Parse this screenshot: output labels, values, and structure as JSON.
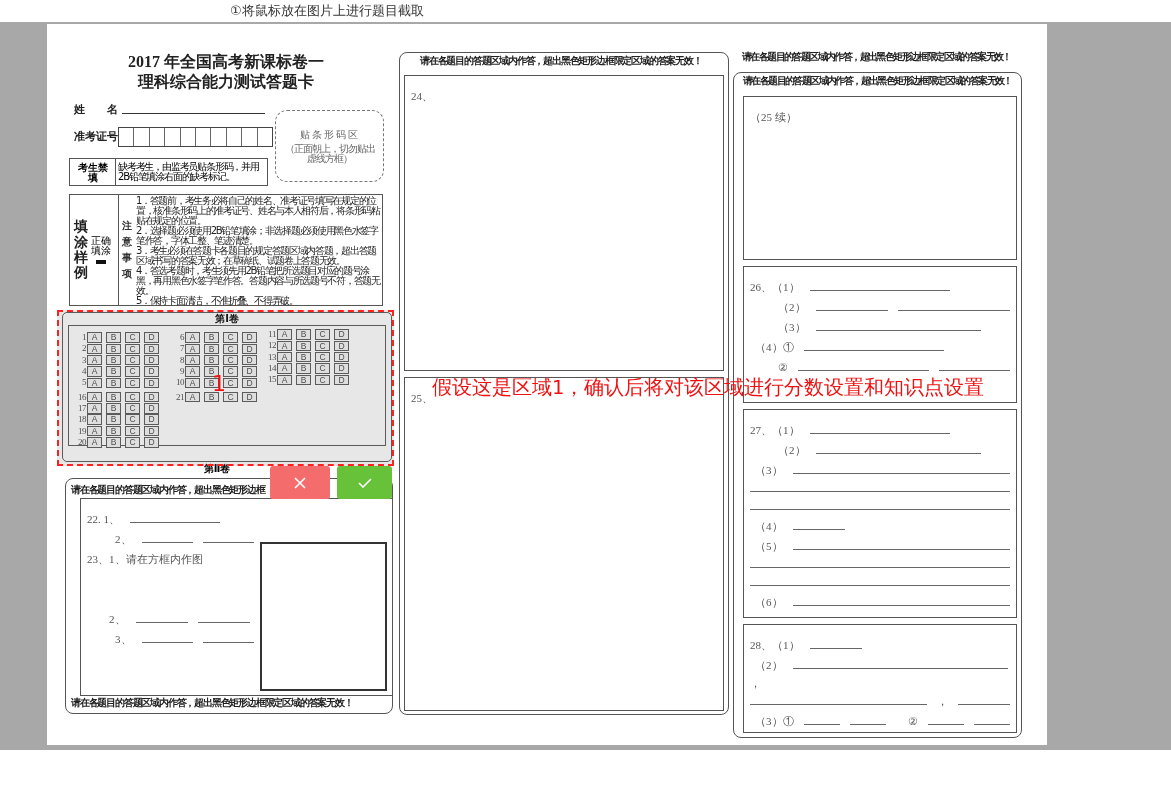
{
  "page_hint": "①将鼠标放在图片上进行题目截取",
  "answer_sheet": {
    "title": [
      "2017 年全国高考新课标卷一",
      "理科综合能力测试答题卡"
    ],
    "name_label": "姓　　名",
    "exam_number_label": "准考证号",
    "barcode_area": {
      "title": "贴条形码区",
      "note": "（正面朝上，切勿贴出虚线方框）"
    },
    "absent": {
      "label": "考生禁填",
      "text": "缺考考生，由监考员贴条形码，并用2B铅笔填涂右面的缺考标记。"
    },
    "fill_example": {
      "label": "填涂样例",
      "sample_label": "正确填涂",
      "notice_label": "注意事项",
      "notices": [
        "1．答题前，考生务必将自己的姓名、准考证号填写在规定的位置，核准条形码上的准考证号、姓名与本人相符后，将条形码粘贴在规定的位置。",
        "2．选择题必须使用2B铅笔填涂；非选择题必须使用黑色水签字笔作答，字体工整、笔迹清楚。",
        "3．考生必须在答题卡各题目的规定答题区域内答题，超出答题区域书写的答案无效；在草稿纸、试题卷上答题无效。",
        "4．答选考题时，考生须先用2B铅笔把所选题目对应的题号涂黑，再用黑色水签字笔作答。答题内容与所选题号不符，答题无效。",
        "5．保持卡面清洁，不准折叠、不得弄破。"
      ]
    },
    "section_1": {
      "title": "第Ⅰ卷",
      "groups": [
        [
          {
            "number": "1",
            "options": [
              "A",
              "B",
              "C",
              "D"
            ]
          },
          {
            "number": "2",
            "options": [
              "A",
              "B",
              "C",
              "D"
            ]
          },
          {
            "number": "3",
            "options": [
              "A",
              "B",
              "C",
              "D"
            ]
          },
          {
            "number": "4",
            "options": [
              "A",
              "B",
              "C",
              "D"
            ]
          },
          {
            "number": "5",
            "options": [
              "A",
              "B",
              "C",
              "D"
            ]
          }
        ],
        [
          {
            "number": "6",
            "options": [
              "A",
              "B",
              "C",
              "D"
            ]
          },
          {
            "number": "7",
            "options": [
              "A",
              "B",
              "C",
              "D"
            ]
          },
          {
            "number": "8",
            "options": [
              "A",
              "B",
              "C",
              "D"
            ]
          },
          {
            "number": "9",
            "options": [
              "A",
              "B",
              "C",
              "D"
            ]
          },
          {
            "number": "10",
            "options": [
              "A",
              "B",
              "C",
              "D"
            ]
          }
        ],
        [
          {
            "number": "11",
            "options": [
              "A",
              "B",
              "C",
              "D"
            ]
          },
          {
            "number": "12",
            "options": [
              "A",
              "B",
              "C",
              "D"
            ]
          },
          {
            "number": "13",
            "options": [
              "A",
              "B",
              "C",
              "D"
            ]
          },
          {
            "number": "14",
            "options": [
              "A",
              "B",
              "C",
              "D"
            ]
          },
          {
            "number": "15",
            "options": [
              "A",
              "B",
              "C",
              "D"
            ]
          }
        ],
        [
          {
            "number": "16",
            "options": [
              "A",
              "B",
              "C",
              "D"
            ]
          },
          {
            "number": "17",
            "options": [
              "A",
              "B",
              "C",
              "D"
            ]
          },
          {
            "number": "18",
            "options": [
              "A",
              "B",
              "C",
              "D"
            ]
          },
          {
            "number": "19",
            "options": [
              "A",
              "B",
              "C",
              "D"
            ]
          },
          {
            "number": "20",
            "options": [
              "A",
              "B",
              "C",
              "D"
            ]
          }
        ],
        [
          {
            "number": "21",
            "options": [
              "A",
              "B",
              "C",
              "D"
            ]
          }
        ]
      ]
    },
    "section_2": {
      "title": "第Ⅱ卷",
      "header": "请在各题目的答题区域内作答，超出黑色矩形边框",
      "rows": [
        {
          "kind": "lead",
          "label": "22. 1、",
          "blanks": [
            {
              "kind": "medium"
            }
          ]
        },
        {
          "kind": "sub",
          "label": "2、",
          "blanks": [
            {
              "kind": "medium"
            },
            {
              "kind": "medium"
            }
          ]
        },
        {
          "kind": "lead",
          "label": "23、1、请在方框内作图",
          "blanks": []
        },
        {
          "kind": "gap",
          "label": "2、",
          "blanks": [
            {
              "kind": "short"
            },
            {
              "kind": "short"
            }
          ]
        },
        {
          "kind": "sub",
          "label": "3、",
          "blanks": [
            {
              "kind": "short"
            },
            {
              "kind": "short"
            }
          ]
        }
      ],
      "footer": "请在各题目的答题区域内作答，超出黑色矩形边框限定区域的答案无效！"
    },
    "middle": {
      "header": "请在各题目的答题区域内作答，超出黑色矩形边框限定区域的答案无效！",
      "blocks": [
        {
          "rows": [
            {
              "kind": "lead",
              "label": "24、",
              "blanks": []
            }
          ]
        },
        {
          "rows": [
            {
              "kind": "lead",
              "label": "25、",
              "blanks": []
            }
          ]
        }
      ]
    },
    "right": {
      "top_note": "请在各题目的答题区域内作答，超出黑色矩形边框限定区域的答案无效！",
      "header": "请在各题目的答题区域内作答，超出黑色矩形边框限定区域的答案无效！",
      "blocks": [
        {
          "rows": [
            {
              "kind": "lead",
              "label": "（25 续）",
              "blanks": []
            }
          ]
        },
        {
          "rows": [
            {
              "kind": "lead",
              "label": "26、（1）",
              "blanks": [
                {
                  "kind": "long"
                }
              ]
            },
            {
              "kind": "sub",
              "label": "（2）",
              "blanks": [
                {
                  "kind": "medium"
                },
                {
                  "kind": "long"
                }
              ]
            },
            {
              "kind": "sub",
              "label": "（3）",
              "blanks": [
                {
                  "kind": "xlong"
                }
              ]
            },
            {
              "kind": "mid",
              "label": "（4）①",
              "blanks": [
                {
                  "kind": "long"
                }
              ]
            },
            {
              "kind": "sub",
              "label": "②",
              "blanks": [
                {
                  "kind": "xlong"
                },
                {
                  "kind": "medium"
                }
              ]
            }
          ]
        },
        {
          "rows": [
            {
              "kind": "lead",
              "label": "27、（1）",
              "blanks": [
                {
                  "kind": "long"
                }
              ]
            },
            {
              "kind": "sub",
              "label": "（2）",
              "blanks": [
                {
                  "kind": "xlong"
                }
              ]
            },
            {
              "kind": "mid",
              "label": "（3）",
              "blanks": [
                {
                  "kind": "fill"
                }
              ]
            },
            {
              "kind": "line",
              "blanks": [
                {
                  "kind": "fill"
                }
              ]
            },
            {
              "kind": "line",
              "blanks": [
                {
                  "kind": "fill"
                }
              ]
            },
            {
              "kind": "mid",
              "label": "（4）",
              "blanks": [
                {
                  "kind": "short"
                }
              ]
            },
            {
              "kind": "mid",
              "label": "（5）",
              "blanks": [
                {
                  "kind": "fill"
                }
              ]
            },
            {
              "kind": "line",
              "blanks": [
                {
                  "kind": "fill"
                }
              ]
            },
            {
              "kind": "line",
              "blanks": [
                {
                  "kind": "fill"
                }
              ]
            },
            {
              "kind": "mid",
              "label": "（6）",
              "blanks": [
                {
                  "kind": "fill"
                }
              ]
            }
          ]
        },
        {
          "rows": [
            {
              "kind": "lead",
              "label": "28、（1）",
              "blanks": [
                {
                  "kind": "short"
                }
              ]
            },
            {
              "kind": "mid",
              "label": "（2）",
              "blanks": [
                {
                  "kind": "xxlong"
                }
              ]
            },
            {
              "kind": "line",
              "label": "，",
              "blanks": []
            },
            {
              "kind": "line",
              "blanks": [
                {
                  "kind": "fill"
                },
                {
                  "kind": "short"
                }
              ],
              "separator": "，"
            },
            {
              "kind": "mid",
              "label": "（3）①",
              "blanks": [
                {
                  "kind": "short"
                },
                {
                  "kind": "short"
                }
              ],
              "second_label": "②",
              "second_blanks": [
                {
                  "kind": "short"
                },
                {
                  "kind": "short"
                }
              ]
            }
          ]
        }
      ]
    }
  },
  "selection": {
    "label": "1",
    "hint": "假设这是区域1，确认后将对该区域进行分数设置和知识点设置"
  }
}
